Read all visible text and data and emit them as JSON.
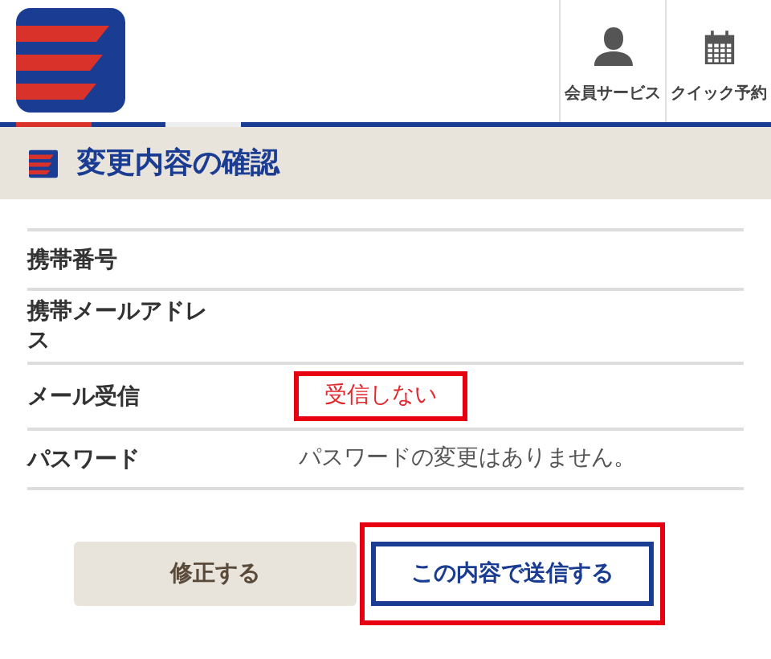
{
  "header": {
    "nav": [
      {
        "label": "会員サービス",
        "kind": "person"
      },
      {
        "label": "クイック予約",
        "kind": "calendar"
      }
    ]
  },
  "page_title": "変更内容の確認",
  "rows": [
    {
      "label": "携帯番号"
    },
    {
      "label": "携帯メールアドレス"
    },
    {
      "label": "メール受信",
      "value": "受信しない",
      "highlighted": true
    },
    {
      "label": "パスワード",
      "value": "パスワードの変更はありません。",
      "highlighted": false
    }
  ],
  "buttons": [
    {
      "label": "修正する",
      "kind": "secondary",
      "highlighted": false
    },
    {
      "label": "この内容で送信する",
      "kind": "primary",
      "highlighted": true
    }
  ]
}
